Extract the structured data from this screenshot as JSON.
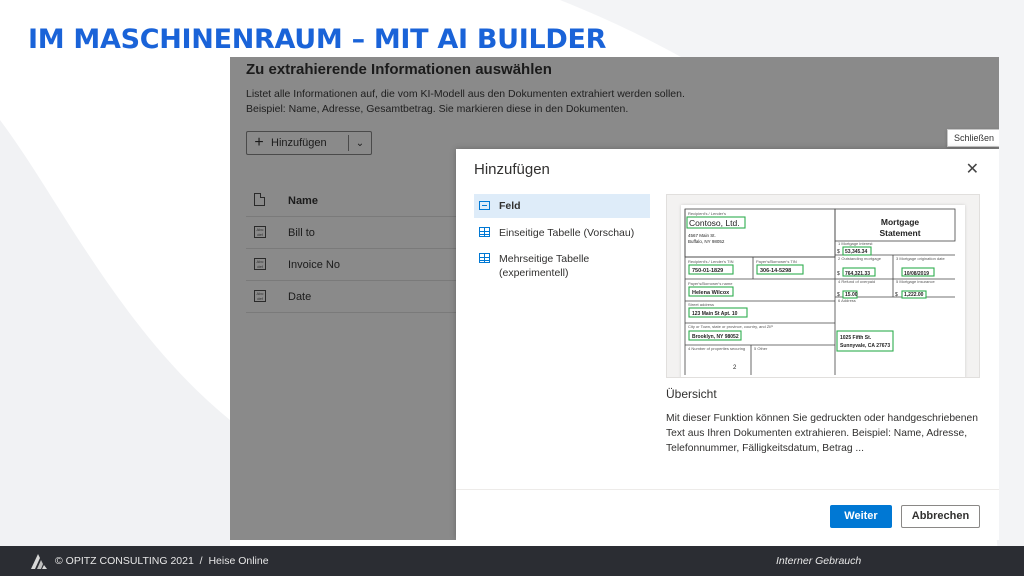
{
  "slide": {
    "title": "IM MASCHINENRAUM – MIT AI BUILDER",
    "footer_copyright": "© OPITZ CONSULTING 2021",
    "footer_separator": "/",
    "footer_source": "Heise Online",
    "footer_classification": "Interner Gebrauch",
    "accent_color": "#1a63d8"
  },
  "background_page": {
    "heading": "Zu extrahierende Informationen auswählen",
    "description_lines": [
      "Listet alle Informationen auf, die vom KI-Modell aus den Dokumenten extrahiert werden sollen.",
      "Beispiel: Name, Adresse, Gesamtbetrag. Sie markieren diese in den Dokumenten."
    ],
    "add_button_label": "Hinzufügen",
    "table": {
      "header": "Name",
      "rows": [
        "Bill to",
        "Invoice No",
        "Date"
      ]
    }
  },
  "dialog": {
    "title": "Hinzufügen",
    "close_tooltip": "Schließen",
    "options": [
      {
        "label": "Feld",
        "icon": "field-icon",
        "selected": true
      },
      {
        "label": "Einseitige Tabelle (Vorschau)",
        "icon": "table-icon",
        "selected": false
      },
      {
        "label": "Mehrseitige Tabelle (experimentell)",
        "icon": "multipage-table-icon",
        "selected": false
      }
    ],
    "preview": {
      "doc_title": [
        "Mortgage",
        "Statement"
      ],
      "recipient_label": "Recipient's / Lender's",
      "recipient_name": "Contoso, Ltd.",
      "recipient_addr1": "4567 Main St.",
      "recipient_addr2": "Buffalo, NY 98052",
      "tin1": "750-01-1829",
      "tin2": "306-14-5298",
      "payer_name": "Helena Wilcox",
      "street": "123 Main St Apt. 10",
      "city": "Brooklyn, NY 98052",
      "interest": "53,345.34",
      "principal": "764,321.33",
      "orig_date": "10/08/2019",
      "refund": "15.00",
      "insurance": "1,222.00",
      "prop_addr1": "1025 Fifth St.",
      "prop_addr2": "Sunnyvale, CA 27673",
      "num_props": "2"
    },
    "overview_title": "Übersicht",
    "overview_lines": [
      "Mit dieser Funktion können Sie gedruckten oder handgeschriebenen",
      "Text aus Ihren Dokumenten extrahieren. Beispiel: Name, Adresse,",
      "Telefonnummer, Fälligkeitsdatum, Betrag ..."
    ],
    "next_label": "Weiter",
    "cancel_label": "Abbrechen",
    "primary_color": "#0078d4"
  }
}
